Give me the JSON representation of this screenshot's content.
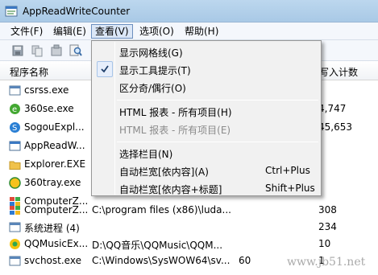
{
  "window": {
    "title": "AppReadWriteCounter"
  },
  "menubar": {
    "items": [
      {
        "label": "文件(F)"
      },
      {
        "label": "编辑(E)"
      },
      {
        "label": "查看(V)"
      },
      {
        "label": "选项(O)"
      },
      {
        "label": "帮助(H)"
      }
    ]
  },
  "columns": {
    "name": "程序名称",
    "write_count": "写入计数"
  },
  "rows": [
    {
      "name": "csrss.exe",
      "path": "",
      "extra": "",
      "count": ""
    },
    {
      "name": "360se.exe",
      "path": "",
      "extra": "",
      "count": "4,747"
    },
    {
      "name": "SogouExpl...",
      "path": "",
      "extra": "",
      "count": "45,653"
    },
    {
      "name": "AppReadW...",
      "path": "",
      "extra": "",
      "count": ""
    },
    {
      "name": "Explorer.EXE",
      "path": "",
      "extra": "",
      "count": ""
    },
    {
      "name": "360tray.exe",
      "path": "",
      "extra": "",
      "count": ""
    },
    {
      "name": "ComputerZ...",
      "path": "",
      "extra": "",
      "count": ""
    },
    {
      "name": "ComputerZ...",
      "path": "C:\\program files (x86)\\luda...",
      "extra": "",
      "count": "308"
    },
    {
      "name": "系统进程 (4)",
      "path": "",
      "extra": "",
      "count": "234"
    },
    {
      "name": "QQMusicEx...",
      "path": "D:\\QQ音乐\\QQMusic\\QQM...",
      "extra": "",
      "count": "10"
    },
    {
      "name": "svchost.exe",
      "path": "C:\\Windows\\SysWOW64\\sv...",
      "extra": "60",
      "count": "1"
    }
  ],
  "view_menu": {
    "items": [
      {
        "label": "显示网格线(G)",
        "shortcut": "",
        "checked": false,
        "disabled": false
      },
      {
        "label": "显示工具提示(T)",
        "shortcut": "",
        "checked": true,
        "disabled": false
      },
      {
        "label": "区分奇/偶行(O)",
        "shortcut": "",
        "checked": false,
        "disabled": false
      },
      {
        "label": "HTML 报表 - 所有项目(H)",
        "shortcut": "",
        "checked": false,
        "disabled": false
      },
      {
        "label": "HTML 报表 - 所有项目(E)",
        "shortcut": "",
        "checked": false,
        "disabled": true
      },
      {
        "label": "选择栏目(N)",
        "shortcut": "",
        "checked": false,
        "disabled": false
      },
      {
        "label": "自动栏宽[依内容](A)",
        "shortcut": "Ctrl+Plus",
        "checked": false,
        "disabled": false
      },
      {
        "label": "自动栏宽[依内容+标题]",
        "shortcut": "Shift+Plus",
        "checked": false,
        "disabled": false
      }
    ]
  },
  "watermark": "www.jb51.net"
}
